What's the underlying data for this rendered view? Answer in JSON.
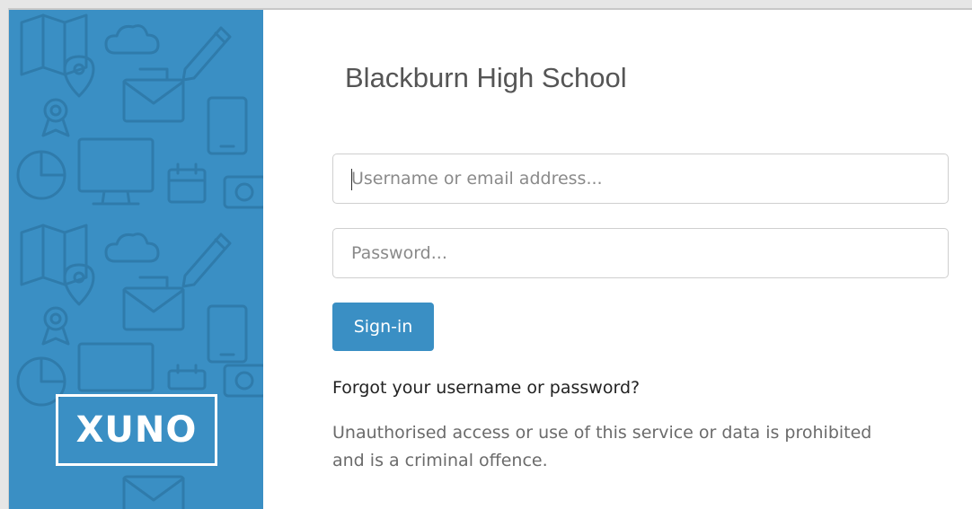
{
  "brand": {
    "logo_text": "XUNO",
    "panel_color": "#3a8fc4"
  },
  "login": {
    "school_name": "Blackburn High School",
    "username_placeholder": "Username or email address...",
    "password_placeholder": "Password...",
    "signin_label": "Sign-in",
    "forgot_label": "Forgot your username or password?",
    "notice_line1": "Unauthorised access or use of this service or data is prohibited",
    "notice_line2": "and is a criminal offence."
  },
  "icons": [
    "map-icon",
    "cloud-icon",
    "pencil-icon",
    "location-pin-icon",
    "envelope-icon",
    "award-icon",
    "tablet-icon",
    "pie-chart-icon",
    "monitor-icon",
    "calendar-icon",
    "camera-icon"
  ]
}
